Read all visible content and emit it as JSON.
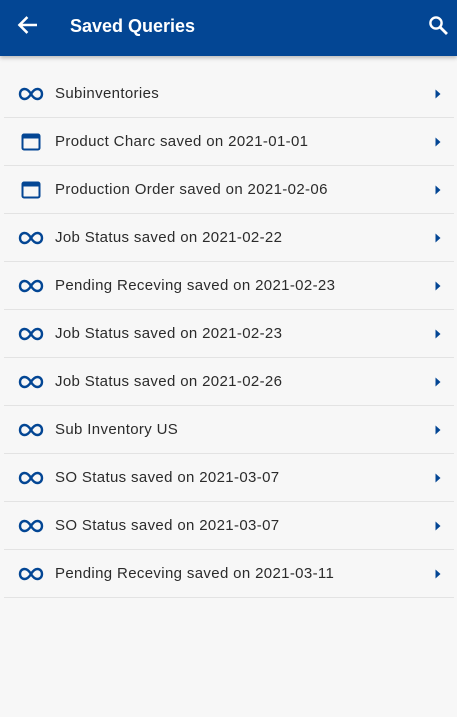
{
  "header": {
    "title": "Saved Queries",
    "back_icon": "arrow-left-icon",
    "search_icon": "search-icon"
  },
  "colors": {
    "header_bg": "#034694",
    "icon_accent": "#034694",
    "background": "#f7f7f7"
  },
  "queries": [
    {
      "label": "Subinventories",
      "icon": "infinity-icon"
    },
    {
      "label": "Product Charc saved on 2021-01-01",
      "icon": "window-icon"
    },
    {
      "label": "Production Order saved on 2021-02-06",
      "icon": "window-icon"
    },
    {
      "label": "Job Status saved on 2021-02-22",
      "icon": "infinity-icon"
    },
    {
      "label": "Pending Receving saved on 2021-02-23",
      "icon": "infinity-icon"
    },
    {
      "label": "Job Status saved on 2021-02-23",
      "icon": "infinity-icon"
    },
    {
      "label": "Job Status saved on 2021-02-26",
      "icon": "infinity-icon"
    },
    {
      "label": "Sub Inventory US",
      "icon": "infinity-icon"
    },
    {
      "label": "SO Status saved on 2021-03-07",
      "icon": "infinity-icon"
    },
    {
      "label": "SO Status saved on 2021-03-07",
      "icon": "infinity-icon"
    },
    {
      "label": "Pending Receving saved on 2021-03-11",
      "icon": "infinity-icon"
    }
  ]
}
